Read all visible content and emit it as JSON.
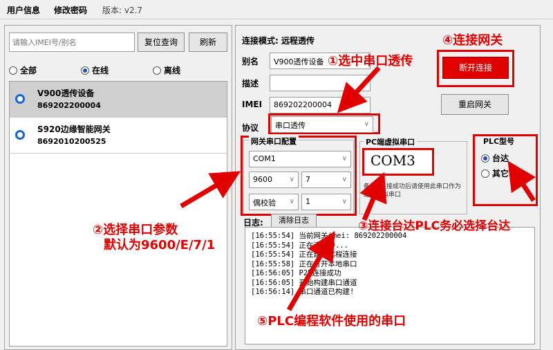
{
  "menu": {
    "user_info": "用户信息",
    "change_pwd": "修改密码",
    "version": "版本: v2.7"
  },
  "left": {
    "search_placeholder": "请输入IMEI号/别名",
    "reset_btn": "复位查询",
    "refresh_btn": "刷新",
    "filters": [
      {
        "label": "全部"
      },
      {
        "label": "在线"
      },
      {
        "label": "离线"
      }
    ],
    "devices": [
      {
        "name": "V900透传设备",
        "id": "869202200004"
      },
      {
        "name": "S920边缘智能网关",
        "id": "8692010200525"
      }
    ]
  },
  "right": {
    "mode_label": "连接模式:",
    "mode_value": "远程透传",
    "alias_label": "别名",
    "alias_value": "V900透传设备",
    "desc_label": "描述",
    "desc_value": "",
    "imei_label": "IMEI",
    "imei_value": "869202200004",
    "proto_label": "协议",
    "proto_value": "串口透传",
    "disconnect_btn": "断开连接",
    "restart_btn": "重启网关",
    "serial_group": "网关串口配置",
    "com_value": "COM1",
    "baud_value": "9600",
    "databits_value": "7",
    "parity_value": "偶校验",
    "stopbits_value": "1",
    "vport_group": "PC端虚拟串口",
    "vport_value": "COM3",
    "vport_note_prefix": "备注:",
    "vport_note": "连接成功后请使用此串口作为远程虚拟串口",
    "plc_group": "PLC型号",
    "plc_delta": "台达",
    "plc_other": "其它",
    "log_label": "日志:",
    "clear_log_btn": "清除日志",
    "logs": [
      "[16:55:54] 当前网关imei: 869202200004",
      "[16:55:54] 正在连接中...",
      "[16:55:54] 正在建立远程连接",
      "[16:55:58] 正在打开本地串口",
      "[16:56:05] P2P连接成功",
      "[16:56:05] 开始构建串口通道",
      "[16:56:14] 串口通道已构建!"
    ]
  },
  "annotations": {
    "a1": "①选中串口透传",
    "a2_l1": "②选择串口参数",
    "a2_l2": "默认为9600/E/7/1",
    "a3": "③连接台达PLC务必选择台达",
    "a4": "④连接网关",
    "a5": "⑤PLC编程软件使用的串口"
  },
  "colors": {
    "accent": "#e00000",
    "radio": "#1565d8"
  }
}
